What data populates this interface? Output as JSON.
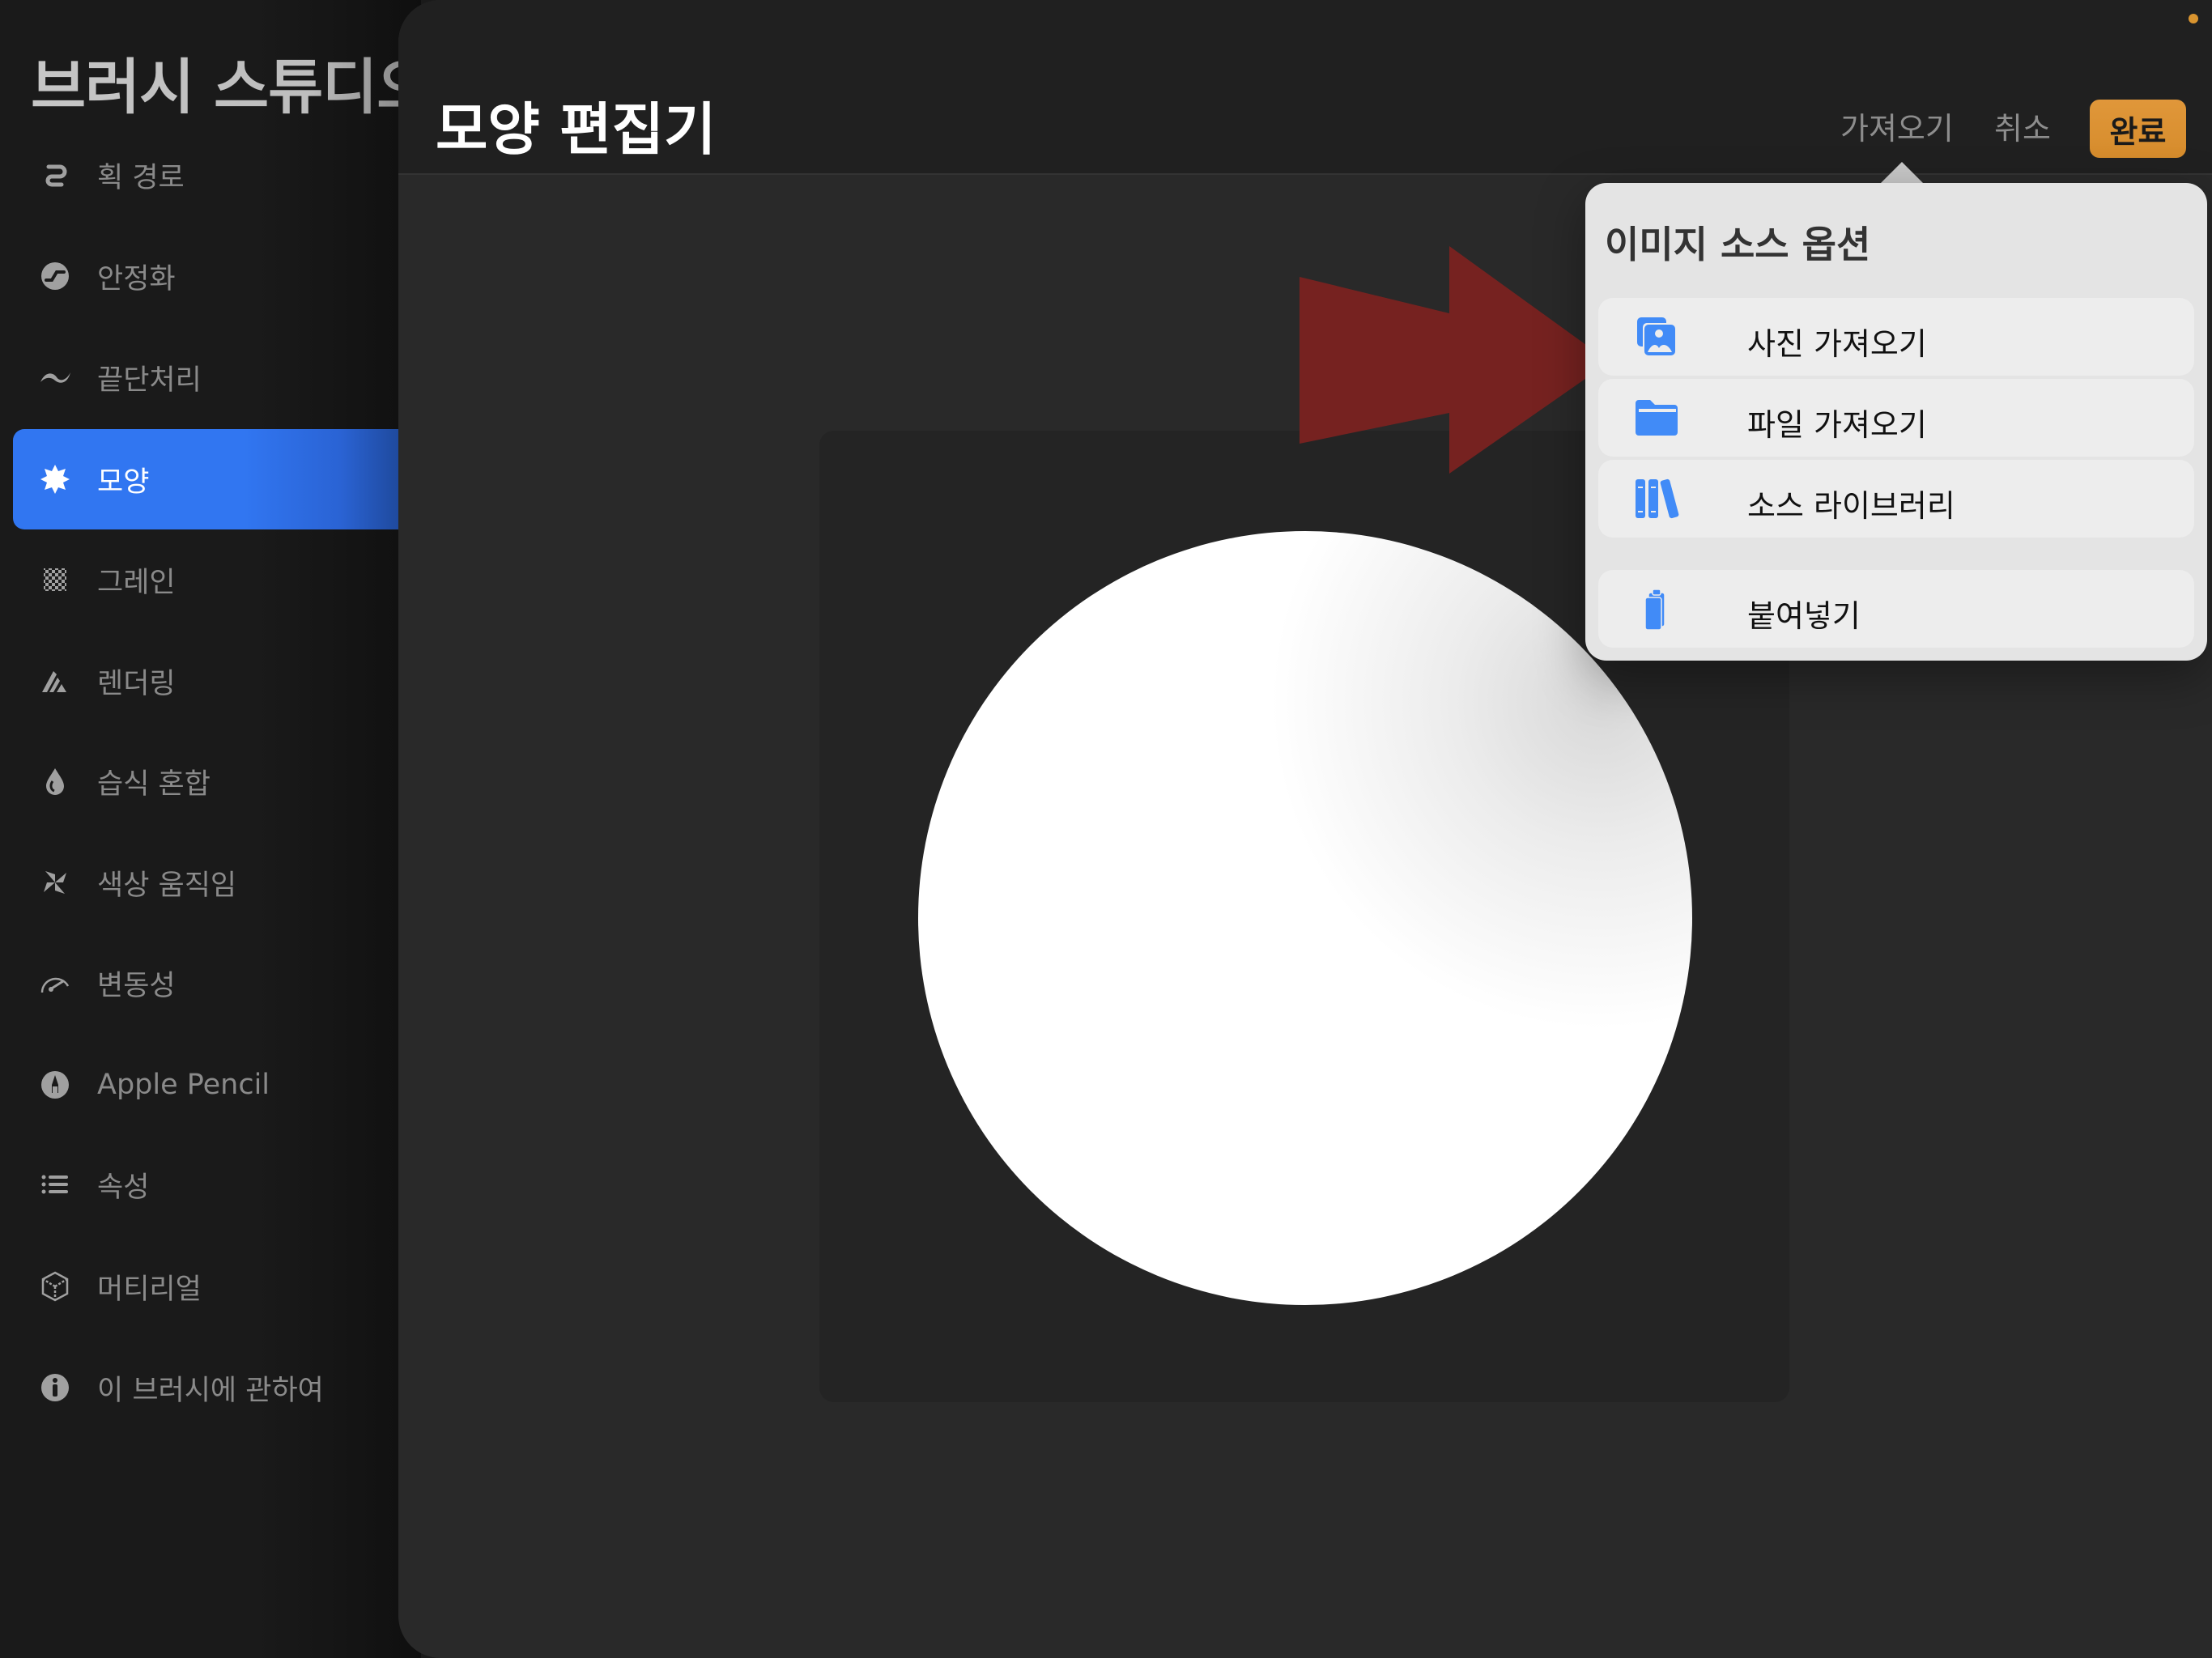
{
  "sidebar": {
    "title": "브러시 스튜디오",
    "items": [
      {
        "label": "획 경로",
        "icon": "stroke-path-icon"
      },
      {
        "label": "안정화",
        "icon": "stabilization-icon"
      },
      {
        "label": "끝단처리",
        "icon": "taper-icon"
      },
      {
        "label": "모양",
        "icon": "shape-icon",
        "active": true
      },
      {
        "label": "그레인",
        "icon": "grain-icon"
      },
      {
        "label": "렌더링",
        "icon": "rendering-icon"
      },
      {
        "label": "습식 혼합",
        "icon": "wet-mix-icon"
      },
      {
        "label": "색상 움직임",
        "icon": "color-dynamics-icon"
      },
      {
        "label": "변동성",
        "icon": "dynamics-icon"
      },
      {
        "label": "Apple Pencil",
        "icon": "apple-pencil-icon"
      },
      {
        "label": "속성",
        "icon": "properties-icon"
      },
      {
        "label": "머티리얼",
        "icon": "materials-icon"
      },
      {
        "label": "이 브러시에 관하여",
        "icon": "info-icon"
      }
    ]
  },
  "header": {
    "title": "모양 편집기",
    "import_label": "가져오기",
    "cancel_label": "취소",
    "done_label": "완료"
  },
  "popover": {
    "title": "이미지 소스 옵션",
    "items": [
      {
        "label": "사진 가져오기",
        "icon": "photos-icon"
      },
      {
        "label": "파일 가져오기",
        "icon": "folder-icon"
      },
      {
        "label": "소스 라이브러리",
        "icon": "library-icon"
      },
      {
        "label": "붙여넣기",
        "icon": "clipboard-icon"
      }
    ]
  },
  "colors": {
    "accent_blue": "#3176f1",
    "icon_blue": "#418bf7",
    "done_orange": "#dc9331",
    "annotation_red": "#7a2220"
  }
}
